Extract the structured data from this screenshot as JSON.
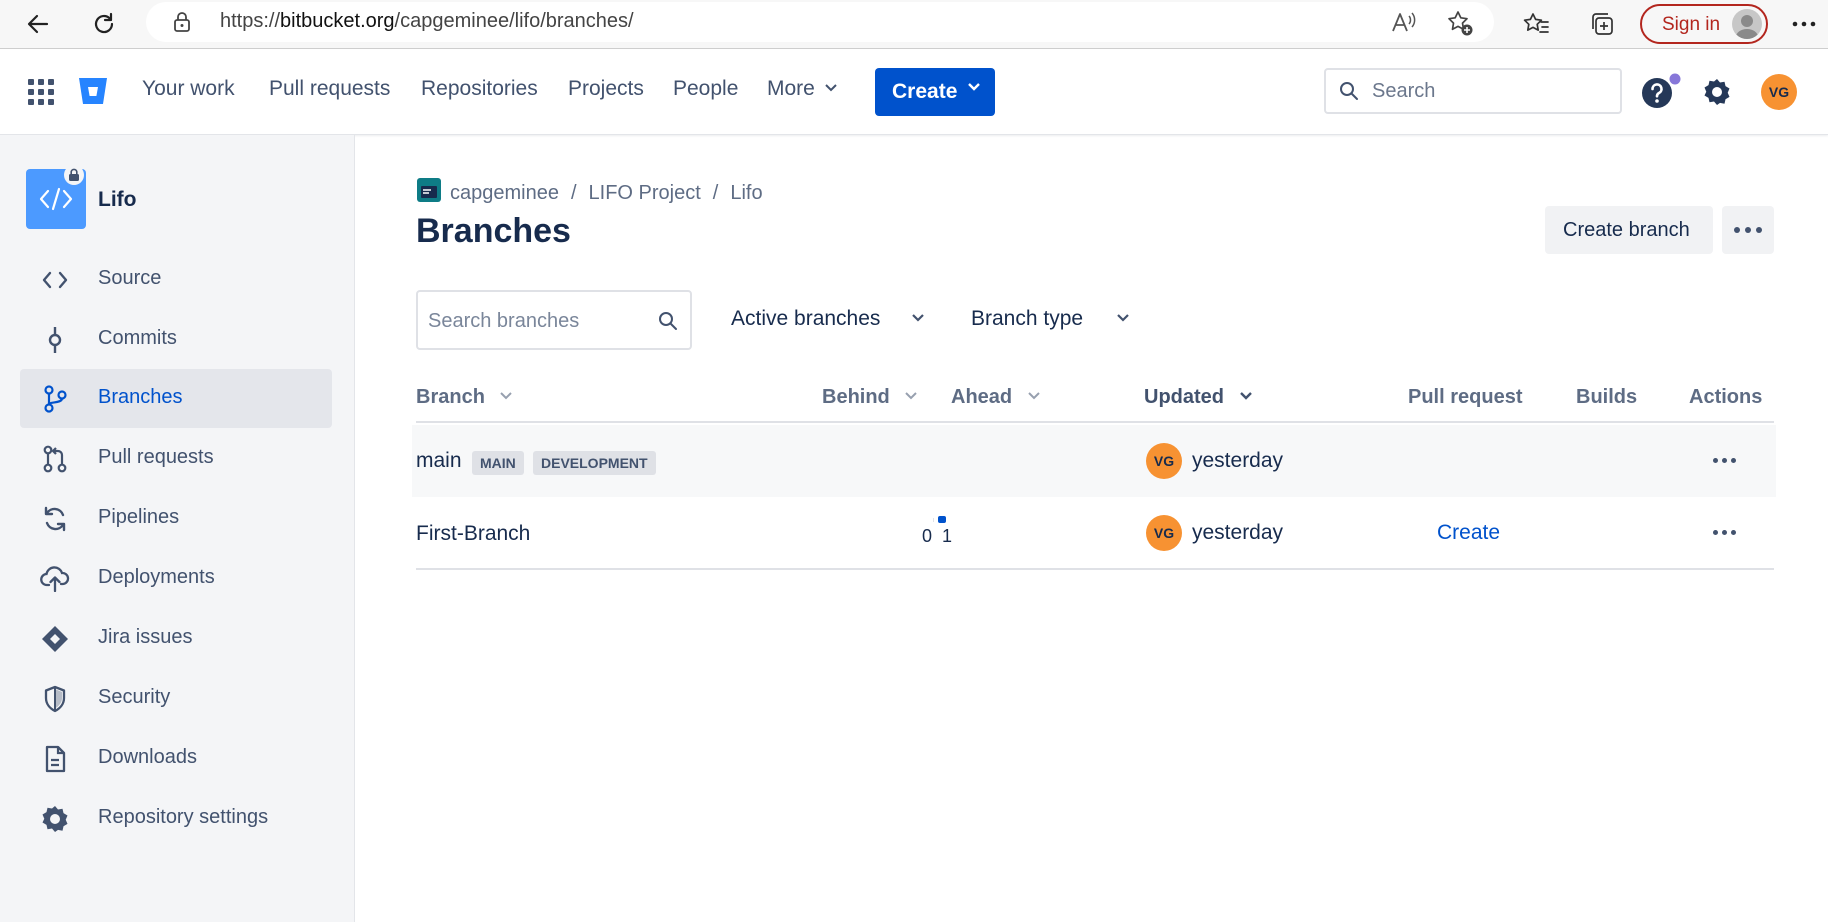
{
  "browser": {
    "url_prefix": "https://",
    "url_host": "bitbucket.org",
    "url_path": "/capgeminee/lifo/branches/",
    "signin_label": "Sign in"
  },
  "topnav": {
    "items": [
      "Your work",
      "Pull requests",
      "Repositories",
      "Projects",
      "People",
      "More"
    ],
    "create_label": "Create",
    "search_placeholder": "Search",
    "user_initials": "VG"
  },
  "sidebar": {
    "repo_name": "Lifo",
    "items": [
      {
        "label": "Source",
        "icon": "code-icon"
      },
      {
        "label": "Commits",
        "icon": "commit-icon"
      },
      {
        "label": "Branches",
        "icon": "branches-icon",
        "active": true
      },
      {
        "label": "Pull requests",
        "icon": "pull-request-icon"
      },
      {
        "label": "Pipelines",
        "icon": "pipelines-icon"
      },
      {
        "label": "Deployments",
        "icon": "cloud-upload-icon"
      },
      {
        "label": "Jira issues",
        "icon": "jira-icon"
      },
      {
        "label": "Security",
        "icon": "shield-icon"
      },
      {
        "label": "Downloads",
        "icon": "document-icon"
      },
      {
        "label": "Repository settings",
        "icon": "gear-icon"
      }
    ]
  },
  "main": {
    "breadcrumb": [
      "capgeminee",
      "LIFO Project",
      "Lifo"
    ],
    "title": "Branches",
    "create_branch_label": "Create branch",
    "search_placeholder": "Search branches",
    "filters": [
      "Active branches",
      "Branch type"
    ],
    "columns": [
      "Branch",
      "Behind",
      "Ahead",
      "Updated",
      "Pull request",
      "Builds",
      "Actions"
    ],
    "rows": [
      {
        "branch": "main",
        "tags": [
          "MAIN",
          "DEVELOPMENT"
        ],
        "behind": "",
        "ahead": "",
        "updated_avatar": "VG",
        "updated": "yesterday",
        "pull_request": ""
      },
      {
        "branch": "First-Branch",
        "tags": [],
        "behind": "0",
        "ahead": "1",
        "updated_avatar": "VG",
        "updated": "yesterday",
        "pull_request": "Create"
      }
    ]
  },
  "colors": {
    "brand": "#0052CC",
    "avatar": "#F79232",
    "sidebar_bg": "#F4F5F7"
  }
}
